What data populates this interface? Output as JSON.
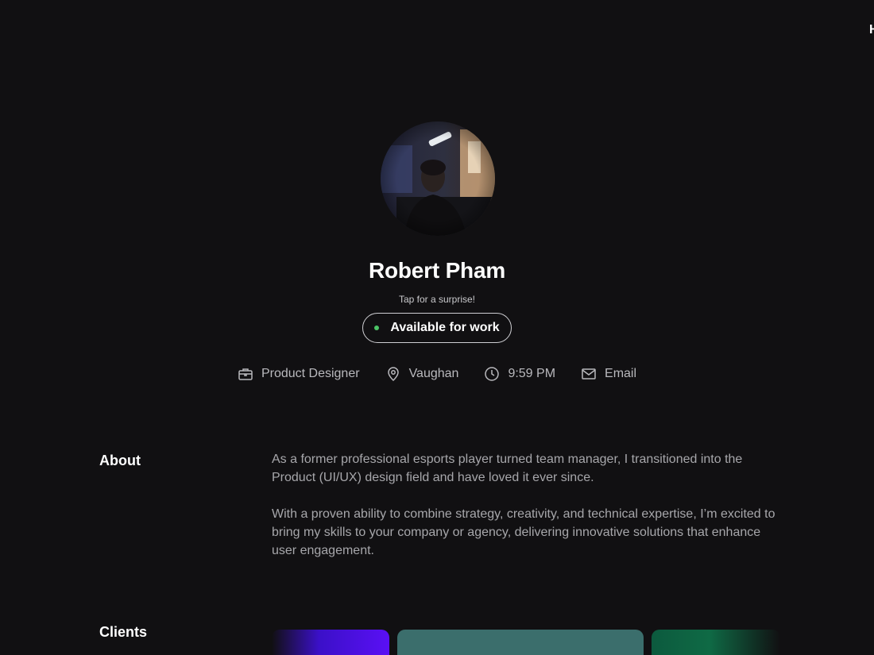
{
  "nav": {
    "edge_label": "H"
  },
  "profile": {
    "name": "Robert Pham",
    "tagline": "Tap for a surprise!",
    "status": "Available for work",
    "status_color": "#4cc466"
  },
  "meta": [
    {
      "icon": "briefcase-icon",
      "label": "Product Designer"
    },
    {
      "icon": "location-pin-icon",
      "label": "Vaughan"
    },
    {
      "icon": "clock-icon",
      "label": "9:59 PM"
    },
    {
      "icon": "mail-icon",
      "label": "Email"
    }
  ],
  "about": {
    "heading": "About",
    "paragraphs": [
      "As a former professional esports player turned team manager, I transitioned into the Product (UI/UX) design field and have loved it ever since.",
      "With a proven ability to combine strategy, creativity, and technical expertise, I’m excited to bring my skills to your company or agency, delivering innovative solutions that enhance user engagement."
    ]
  },
  "clients": {
    "heading": "Clients",
    "card_colors": [
      "#5a10f5",
      "#3b6e6c",
      "#0f6a45"
    ]
  },
  "theme": {
    "background": "#111012",
    "text_primary": "#ffffff",
    "text_secondary": "#a7a7ab"
  }
}
